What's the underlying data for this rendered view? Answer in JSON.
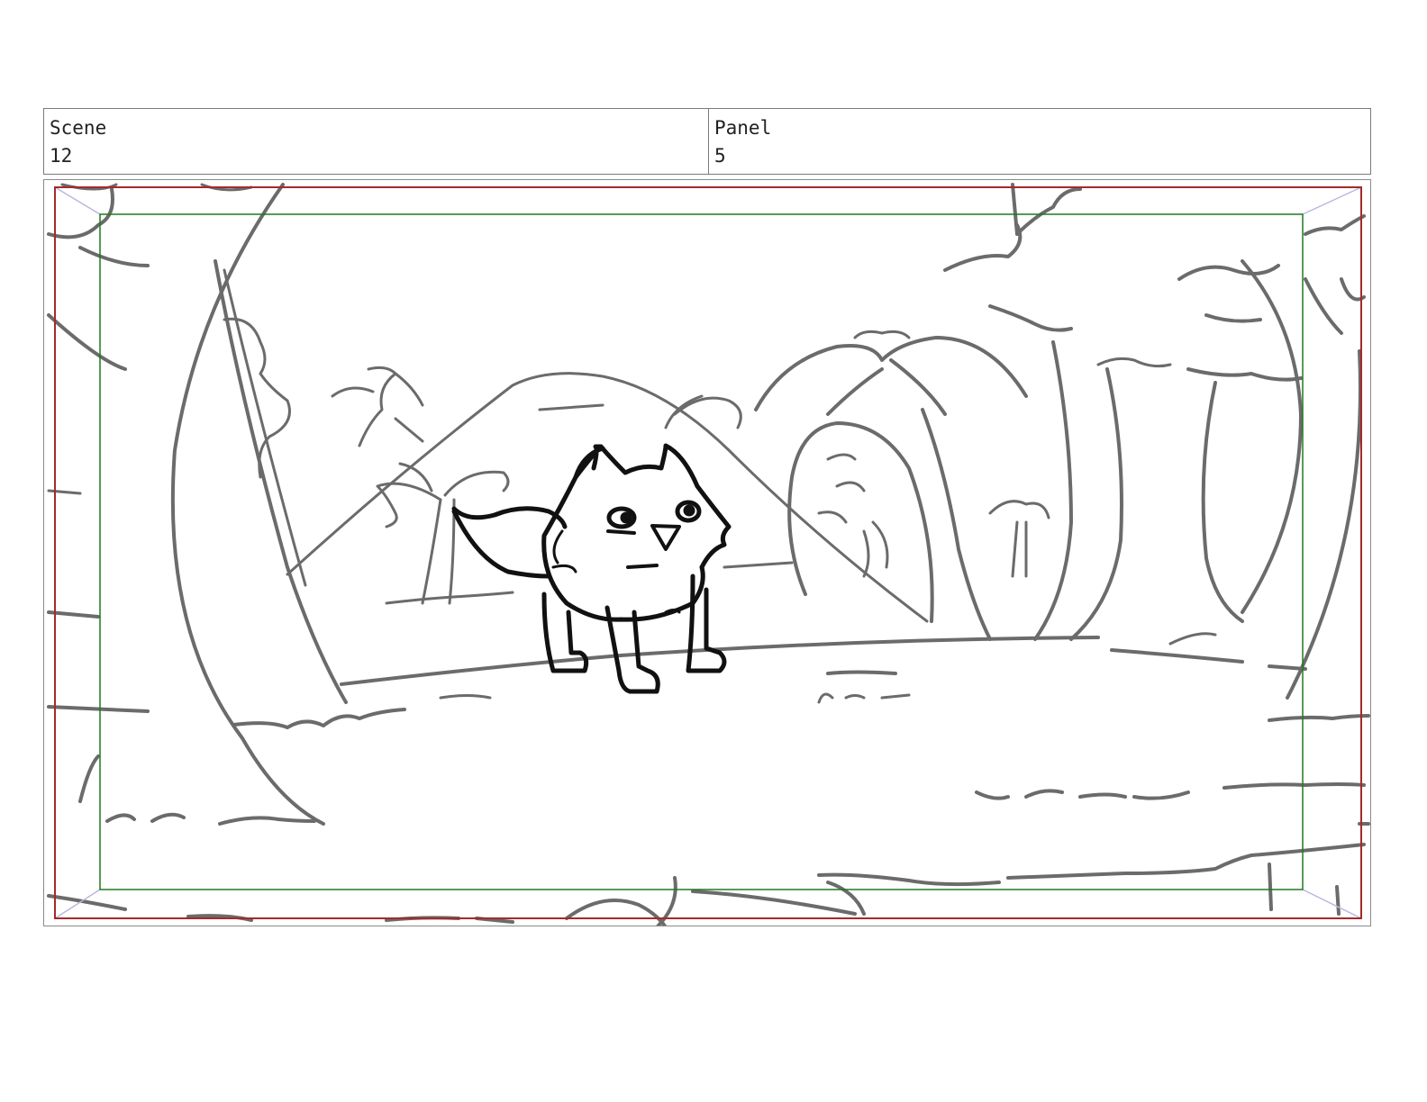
{
  "header": {
    "scene": {
      "label": "Scene",
      "value": "12"
    },
    "panel": {
      "label": "Panel",
      "value": "5"
    }
  },
  "guides": {
    "action_safe_color": "#a52a2a",
    "title_safe_color": "#1f7a1f",
    "corner_line_color": "#b8b8e0"
  },
  "drawing": {
    "background_stroke": "#6b6b6b",
    "character_stroke": "#111111"
  }
}
